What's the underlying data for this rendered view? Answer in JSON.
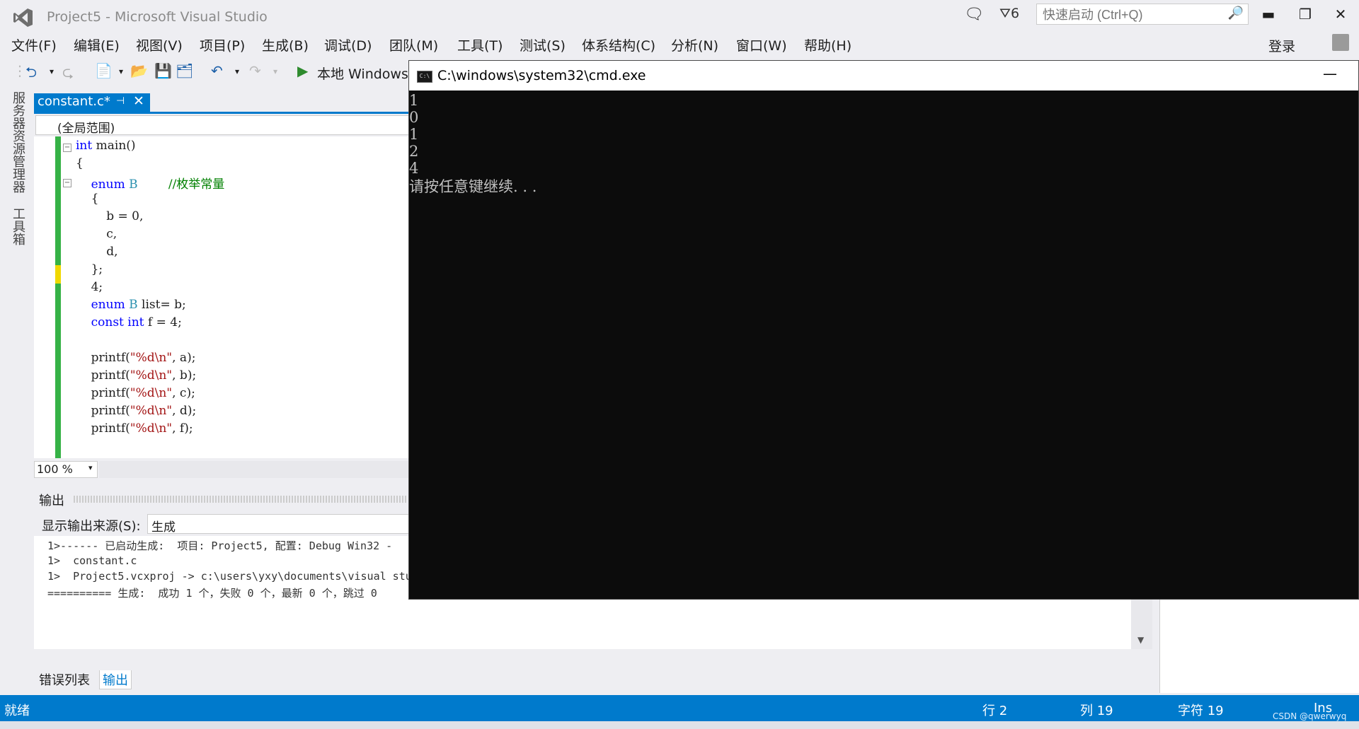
{
  "window": {
    "title": "Project5 - Microsoft Visual Studio"
  },
  "titlebar": {
    "notification_count": "",
    "filter_count": "6",
    "quick_launch_placeholder": "快速启动 (Ctrl+Q)",
    "minimize": "▬",
    "restore": "❐",
    "close": "✕"
  },
  "menu": {
    "items": [
      "文件(F)",
      "编辑(E)",
      "视图(V)",
      "项目(P)",
      "生成(B)",
      "调试(D)",
      "团队(M)",
      "工具(T)",
      "测试(S)",
      "体系结构(C)",
      "分析(N)",
      "窗口(W)",
      "帮助(H)"
    ],
    "signin": "登录"
  },
  "toolbar": {
    "run_label": "本地 Windows"
  },
  "sidepanel": {
    "tabs": [
      "服务器资源管理器",
      "工具箱"
    ]
  },
  "editor": {
    "tab_title": "constant.c*",
    "scope": "(全局范围)",
    "zoom": "100 %",
    "lines": [
      "int main()",
      "{",
      "    enum B        //枚举常量",
      "    {",
      "        b = 0,",
      "        c,",
      "        d,",
      "    };",
      "    4;",
      "    enum B list= b;",
      "    const int f = 4;",
      "",
      "    printf(\"%d\\n\", a);",
      "    printf(\"%d\\n\", b);",
      "    printf(\"%d\\n\", c);",
      "    printf(\"%d\\n\", d);",
      "    printf(\"%d\\n\", f);"
    ]
  },
  "output": {
    "title": "输出",
    "source_label": "显示输出来源(S):",
    "source_value": "生成",
    "lines": [
      "1>------ 已启动生成:  项目: Project5, 配置: Debug Win32 -",
      "1>  constant.c",
      "1>  Project5.vcxproj -> c:\\users\\yxy\\documents\\visual stu",
      "========== 生成:  成功 1 个，失败 0 个，最新 0 个，跳过 0"
    ],
    "tabs": [
      "错误列表",
      "输出"
    ]
  },
  "status": {
    "ready": "就绪",
    "line": "行 2",
    "col": "列 19",
    "char": "字符 19",
    "mode": "Ins",
    "watermark": "CSDN @qwerwyq"
  },
  "console": {
    "title": "C:\\windows\\system32\\cmd.exe",
    "minimize": "—",
    "lines": [
      "1",
      "0",
      "1",
      "2",
      "4",
      "请按任意键继续. . ."
    ]
  },
  "colors": {
    "accent": "#007acc",
    "gutter_changed": "#36b246",
    "gutter_unsaved": "#f0d800",
    "console_bg": "#0c0c0c"
  }
}
